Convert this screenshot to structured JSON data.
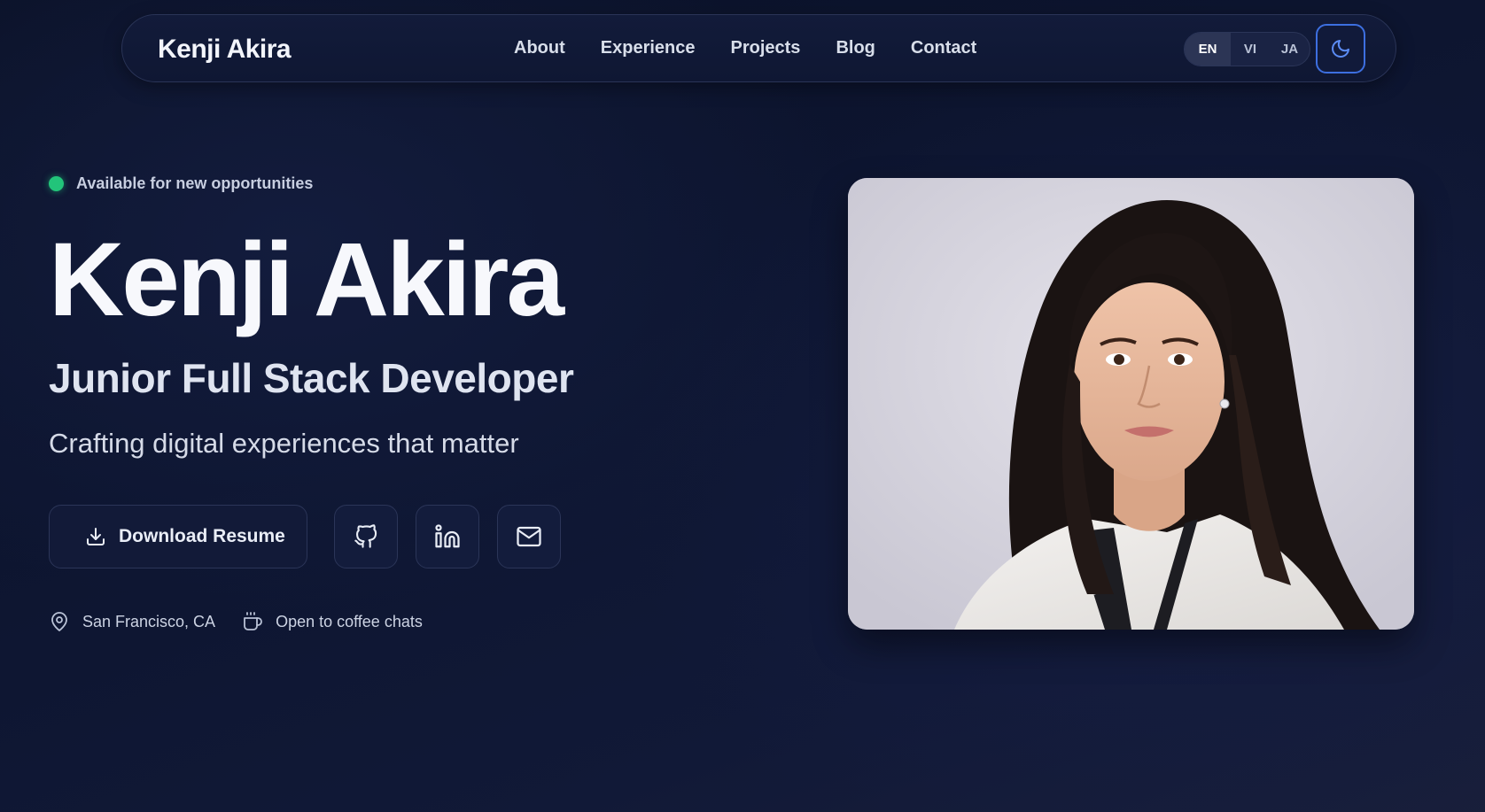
{
  "nav": {
    "brand": "Kenji Akira",
    "links": [
      "About",
      "Experience",
      "Projects",
      "Blog",
      "Contact"
    ],
    "languages": [
      "EN",
      "VI",
      "JA"
    ],
    "active_language": "EN",
    "theme_icon": "moon-icon"
  },
  "hero": {
    "status": "Available for new opportunities",
    "name": "Kenji Akira",
    "role": "Junior Full Stack Developer",
    "tagline": "Crafting digital experiences that matter",
    "resume_button": "Download Resume",
    "social_icons": [
      "github-icon",
      "linkedin-icon",
      "mail-icon"
    ],
    "location": "San Francisco, CA",
    "coffee": "Open to coffee chats"
  },
  "colors": {
    "background": "#0d1530",
    "accent": "#3d6fe0",
    "status_green": "#22c47a"
  }
}
